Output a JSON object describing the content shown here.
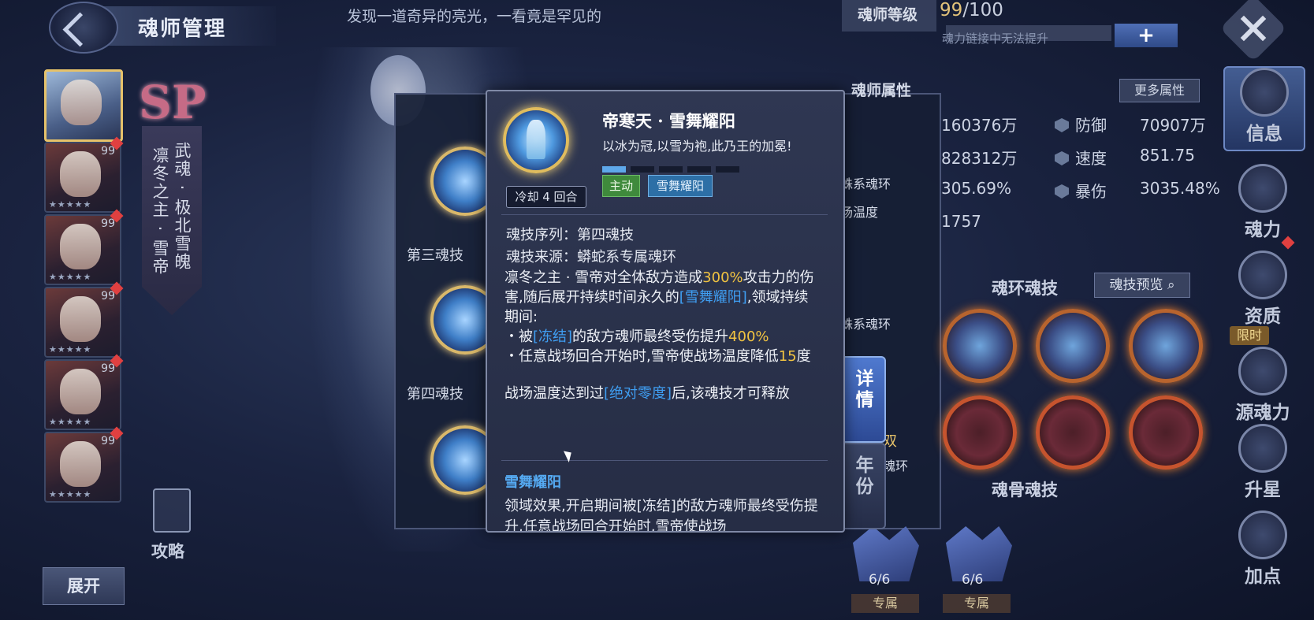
{
  "header": {
    "page_title": "魂师管理",
    "banner_text": "发现一道奇异的亮光，一看竟是罕见的"
  },
  "level": {
    "label": "魂师等级",
    "current": "99",
    "max": "/100",
    "note": "魂力链接中无法提升",
    "plus": "+"
  },
  "attributes": {
    "section_label": "魂师属性",
    "more_label": "更多属性",
    "rows": [
      {
        "value_left": "160376万",
        "name": "防御",
        "value_right": "70907万"
      },
      {
        "value_left": "828312万",
        "name": "速度",
        "value_right": "851.75"
      },
      {
        "value_left": "305.69%",
        "name": "暴伤",
        "value_right": "3035.48%"
      },
      {
        "value_left": "1757"
      }
    ]
  },
  "hero": {
    "sp_label": "SP",
    "martial_soul_line": "武魂 · 极北雪魄",
    "name_line": "凛冬之主 · 雪帝"
  },
  "roster": {
    "levels": [
      "99",
      "99",
      "99",
      "99",
      "99"
    ],
    "expand_label": "展开"
  },
  "guide_label": "攻略",
  "mid_panel": {
    "skill3_label": "第三魂技",
    "skill4_label": "第四魂技",
    "ring_text_1": "蛛系魂环",
    "ring_text_2": "场温度",
    "ring_text_3": "蛛系魂环",
    "ring_text_4": "双",
    "ring_text_5": "魂环"
  },
  "soul_ring_section": {
    "title": "魂环魂技",
    "preview_label": "魂技预览"
  },
  "soul_bone_section": {
    "title": "魂骨魂技",
    "bones": [
      {
        "count": "6/6",
        "tag": "专属"
      },
      {
        "count": "6/6",
        "tag": "专属"
      }
    ]
  },
  "side_tabs": [
    {
      "label": "信息",
      "icon": "info-icon"
    },
    {
      "label": "魂力",
      "icon": "soul-power-icon"
    },
    {
      "label": "资质",
      "icon": "aptitude-icon"
    },
    {
      "label": "源魂力",
      "icon": "source-soul-icon"
    },
    {
      "label": "升星",
      "icon": "star-up-icon"
    },
    {
      "label": "加点",
      "icon": "add-points-icon"
    }
  ],
  "limit_badge": "限时",
  "detail_buttons": {
    "detail": "详情",
    "year": "年份"
  },
  "skill_modal": {
    "title": "帝寒天 · 雪舞耀阳",
    "subtitle": "以冰为冠,以雪为袍,此乃王的加冕!",
    "cooldown": "冷却 4 回合",
    "level_progress": 0.2,
    "tag_type": "主动",
    "tag_skill": "雪舞耀阳",
    "order_label": "魂技序列：第四魂技",
    "source_label": "魂技来源：蟒蛇系专属魂环",
    "desc_p1_a": "凛冬之主 · 雪帝对全体敌方造成",
    "desc_p1_pct": "300%",
    "desc_p1_b": "攻击力的伤害,随后展开持续时间永久的",
    "desc_p1_link": "[雪舞耀阳]",
    "desc_p1_c": ",领域持续期间:",
    "desc_b1_a": "・被",
    "desc_b1_link": "[冻结]",
    "desc_b1_b": "的敌方魂师最终受伤提升",
    "desc_b1_pct": "400%",
    "desc_b2_a": "・任意战场回合开始时,雪帝使战场温度降低",
    "desc_b2_num": "15",
    "desc_b2_b": "度",
    "desc_p2_a": "战场温度达到过",
    "desc_p2_link": "[绝对零度]",
    "desc_p2_b": "后,该魂技才可释放",
    "sub_title": "雪舞耀阳",
    "sub_desc": "领域效果,开启期间被[冻结]的敌方魂师最终受伤提升,任意战场回合开始时,雪帝使战场"
  }
}
